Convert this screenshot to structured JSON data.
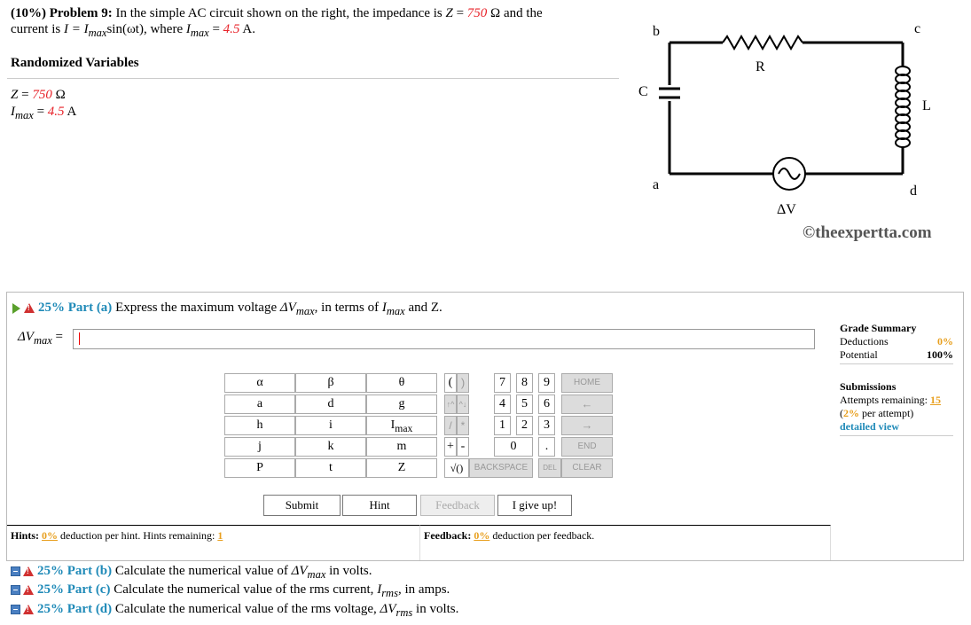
{
  "problem": {
    "prefix": "(10%)",
    "label": "Problem 9:",
    "text1": "In the simple AC circuit shown on the right, the impedance is",
    "Z_expr": "Z",
    "Z_value": "750",
    "Z_unit": "Ω",
    "text2": "and the",
    "text3": "current is",
    "I_expr": "I = I",
    "sub_max": "max",
    "sin_part": "sin(ωt), where",
    "Imax_value": "4.5",
    "Imax_unit": "A."
  },
  "randomized_variables": {
    "title": "Randomized Variables",
    "z_line_label": "Z =",
    "z_value": "750",
    "z_unit": "Ω",
    "i_label": "I",
    "i_sub": "max",
    "i_value": "4.5",
    "i_unit": "A"
  },
  "circuit": {
    "labels": {
      "b": "b",
      "c": "c",
      "a": "a",
      "d": "d",
      "R": "R",
      "L": "L",
      "C": "C",
      "dV": "ΔV"
    },
    "copyright": "©theexpertta.com"
  },
  "part_a": {
    "pct": "25%",
    "name": "Part (a)",
    "text1": "Express the maximum voltage",
    "var": "ΔV",
    "sub": "max",
    "text2": ", in terms of",
    "ivar": "I",
    "isub": "max",
    "text3": "and Z.",
    "answer_label": "ΔV",
    "answer_sub": "max",
    "answer_eq": "=",
    "answer_value": ""
  },
  "grade_summary": {
    "title": "Grade Summary",
    "deductions_label": "Deductions",
    "deductions_value": "0%",
    "potential_label": "Potential",
    "potential_value": "100%",
    "submissions_title": "Submissions",
    "attempts_label": "Attempts remaining:",
    "attempts_value": "15",
    "per_attempt_pct": "2%",
    "per_attempt_text": "per attempt)",
    "detailed_view": "detailed view"
  },
  "keypad": {
    "vars": [
      [
        "α",
        "β",
        "θ"
      ],
      [
        "a",
        "d",
        "g"
      ],
      [
        "h",
        "i",
        "Imax"
      ],
      [
        "j",
        "k",
        "m"
      ],
      [
        "P",
        "t",
        "Z"
      ]
    ],
    "paren_open": "(",
    "paren_close": ")",
    "arrow_up": "↑^",
    "arrow_down": "^↓",
    "star": "*",
    "slash": "/",
    "plus": "+",
    "minus": "-",
    "sqrt": "√()",
    "digits": [
      [
        "7",
        "8",
        "9"
      ],
      [
        "4",
        "5",
        "6"
      ],
      [
        "1",
        "2",
        "3"
      ]
    ],
    "zero": "0",
    "dot": ".",
    "home": "HOME",
    "left_arrow": "←",
    "right_arrow": "→",
    "end": "END",
    "backspace": "BACKSPACE",
    "del": "DEL",
    "clear": "CLEAR"
  },
  "buttons": {
    "submit": "Submit",
    "hint": "Hint",
    "feedback": "Feedback",
    "give_up": "I give up!"
  },
  "hints": {
    "label": "Hints:",
    "pct": "0%",
    "text": "deduction per hint. Hints remaining:",
    "remaining": "1"
  },
  "feedback": {
    "label": "Feedback:",
    "pct": "0%",
    "text": "deduction per feedback."
  },
  "other_parts": [
    {
      "pct": "25%",
      "name": "Part (b)",
      "text": "Calculate the numerical value of",
      "var": "ΔV",
      "sub": "max",
      "tail": "in volts."
    },
    {
      "pct": "25%",
      "name": "Part (c)",
      "text": "Calculate the numerical value of the rms current,",
      "var": "I",
      "sub": "rms",
      "tail": ", in amps."
    },
    {
      "pct": "25%",
      "name": "Part (d)",
      "text": "Calculate the numerical value of the rms voltage,",
      "var": "ΔV",
      "sub": "rms",
      "tail": "in volts."
    }
  ]
}
